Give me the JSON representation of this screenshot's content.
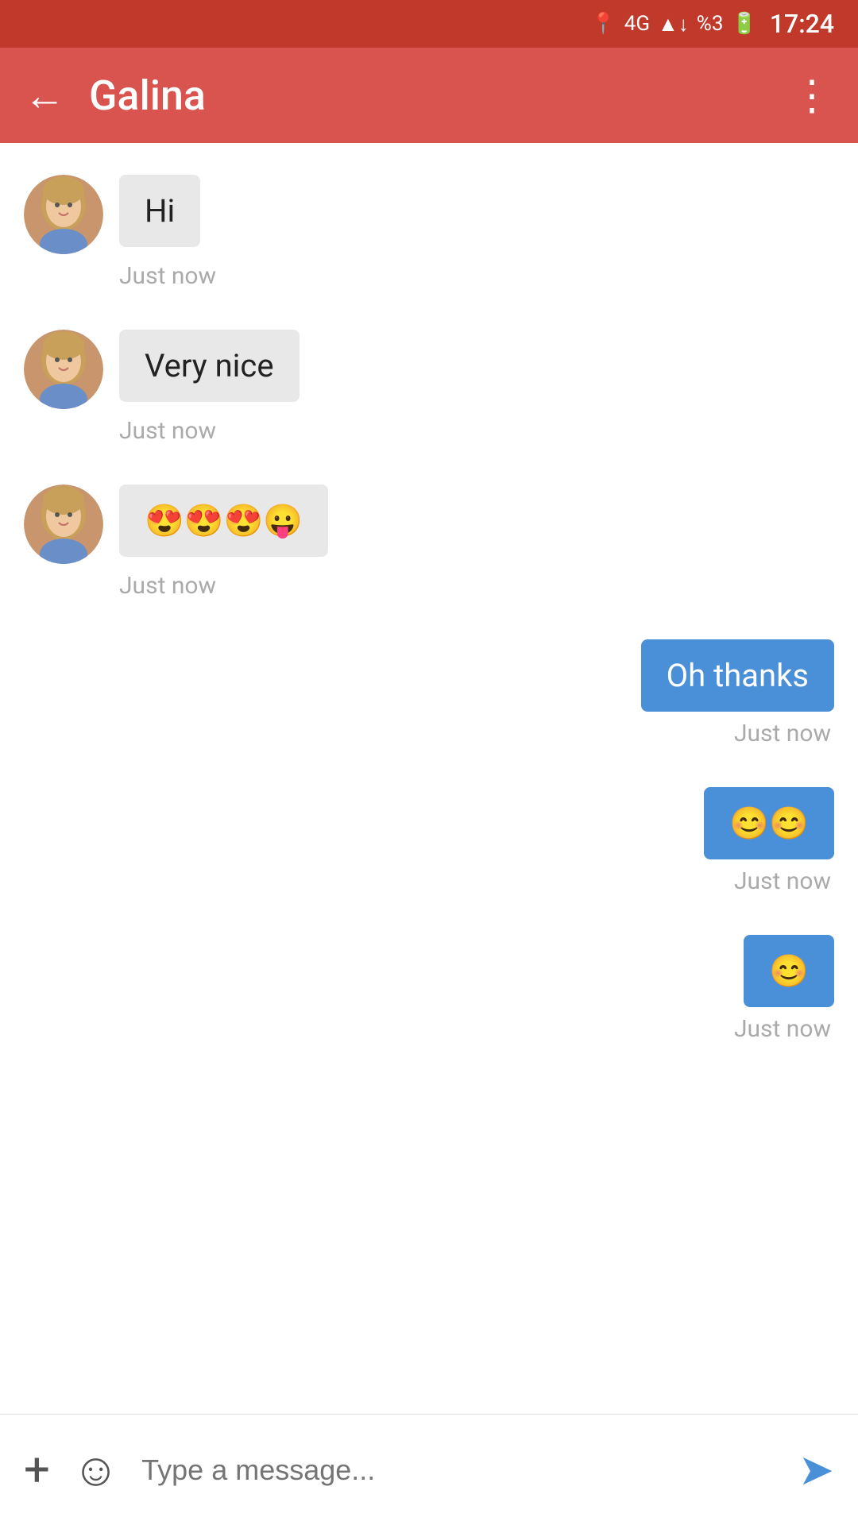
{
  "status_bar": {
    "time": "17:24",
    "battery": "%3",
    "icons": "4G ▲↓ signal"
  },
  "header": {
    "back_label": "←",
    "title": "Galina",
    "more_label": "⋮"
  },
  "messages": [
    {
      "id": "msg1",
      "type": "received",
      "text": "Hi",
      "timestamp": "Just now",
      "has_avatar": true
    },
    {
      "id": "msg2",
      "type": "received",
      "text": "Very nice",
      "timestamp": "Just now",
      "has_avatar": true
    },
    {
      "id": "msg3",
      "type": "received",
      "text": "😍😍😍😛",
      "timestamp": "Just now",
      "has_avatar": true
    },
    {
      "id": "msg4",
      "type": "sent",
      "text": "Oh thanks",
      "timestamp": "Just now",
      "has_avatar": false
    },
    {
      "id": "msg5",
      "type": "sent",
      "text": "😊😊",
      "timestamp": "Just now",
      "has_avatar": false
    },
    {
      "id": "msg6",
      "type": "sent",
      "text": "😊",
      "timestamp": "Just now",
      "has_avatar": false
    }
  ],
  "input_bar": {
    "placeholder": "Type a message...",
    "add_icon": "+",
    "emoji_icon": "☺",
    "send_icon": "➤"
  }
}
